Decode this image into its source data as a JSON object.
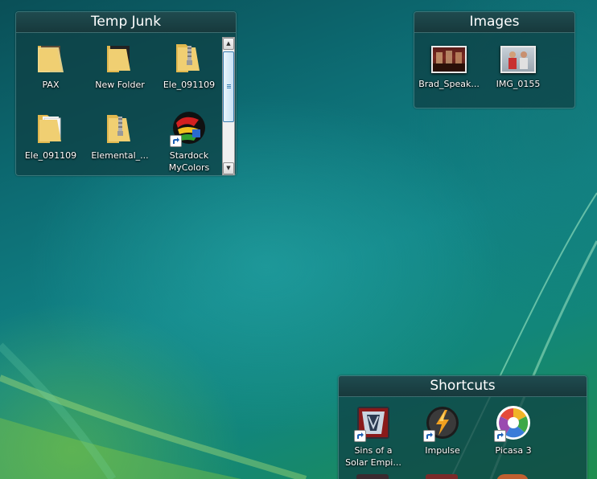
{
  "fences": {
    "temp_junk": {
      "title": "Temp Junk",
      "items": [
        {
          "label": "PAX",
          "icon": "folder-icon"
        },
        {
          "label": "New Folder",
          "icon": "folder-icon"
        },
        {
          "label": "Ele_091109",
          "icon": "zip-folder-icon"
        },
        {
          "label": "Ele_091109",
          "icon": "folder-icon"
        },
        {
          "label": "Elemental_...",
          "icon": "zip-folder-icon"
        },
        {
          "label": "Stardock MyColors",
          "icon": "mycolors-icon"
        }
      ],
      "scroll_up": "▲",
      "scroll_down": "▼"
    },
    "images": {
      "title": "Images",
      "items": [
        {
          "label": "Brad_Speak...",
          "icon": "photo-thumbnail-icon"
        },
        {
          "label": "IMG_0155",
          "icon": "photo-thumbnail-icon"
        }
      ]
    },
    "shortcuts": {
      "title": "Shortcuts",
      "items": [
        {
          "label": "Sins of a Solar Empi...",
          "icon": "sins-game-icon"
        },
        {
          "label": "Impulse",
          "icon": "impulse-icon"
        },
        {
          "label": "Picasa 3",
          "icon": "picasa-icon"
        }
      ]
    }
  },
  "colors": {
    "fence_bg": "#0e3e42",
    "desktop_teal": "#118486",
    "desktop_green": "#1f8e4e"
  }
}
